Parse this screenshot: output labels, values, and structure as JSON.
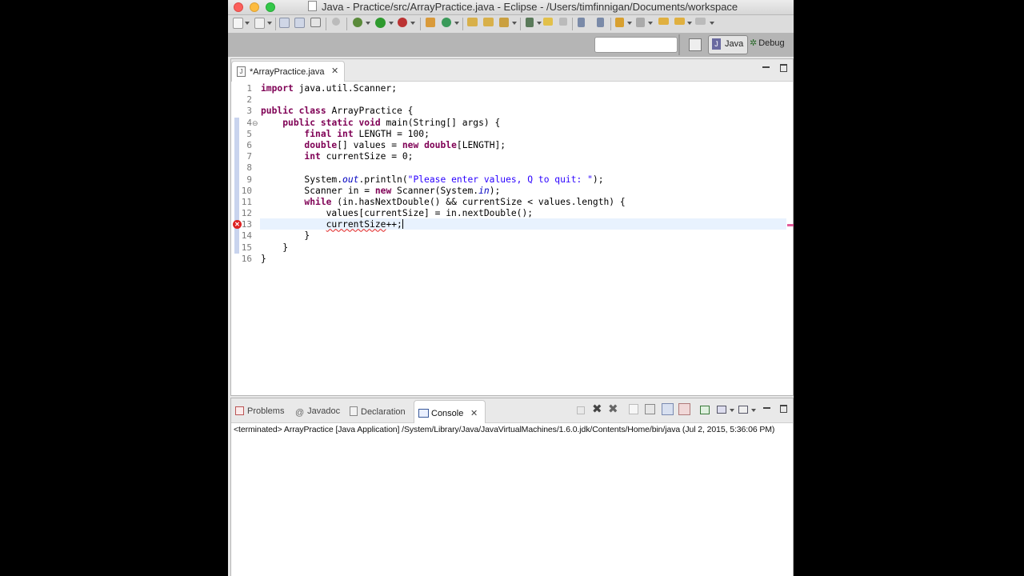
{
  "window": {
    "title": "Java - Practice/src/ArrayPractice.java - Eclipse - /Users/timfinnigan/Documents/workspace",
    "traffic_lights": {
      "close": "#fc605c",
      "minimize": "#fdbc40",
      "zoom": "#34c84a"
    }
  },
  "toolbar": {
    "icons": [
      "new-icon",
      "save-icon",
      "save-all-icon",
      "print-icon",
      "toggle-breakpoint-icon",
      "debug-icon",
      "run-icon",
      "external-tools-icon",
      "new-java-package-icon",
      "new-java-class-icon",
      "open-type-icon",
      "open-task-icon",
      "search-icon",
      "open-perspective-icon",
      "annotation-icon",
      "next-annotation-icon",
      "prev-annotation-icon",
      "back-icon",
      "forward-icon"
    ]
  },
  "quick_access": {
    "placeholder": ""
  },
  "perspectives": {
    "java_label": "Java",
    "debug_label": "Debug"
  },
  "editor": {
    "tab_label": "*ArrayPractice.java",
    "line_numbers": [
      "1",
      "2",
      "3",
      "4",
      "5",
      "6",
      "7",
      "8",
      "9",
      "10",
      "11",
      "12",
      "13",
      "14",
      "15",
      "16"
    ],
    "error_line": "13",
    "code": {
      "l1_kw": "import",
      "l1_rest": " java.util.Scanner;",
      "l3_kw1": "public",
      "l3_kw2": "class",
      "l3_rest": " ArrayPractice {",
      "l4_indent": "    ",
      "l4_kw1": "public",
      "l4_kw2": "static",
      "l4_kw3": "void",
      "l4_rest": " main(String[] args) {",
      "l5_indent": "        ",
      "l5_kw1": "final",
      "l5_kw2": "int",
      "l5_rest": " LENGTH = 100;",
      "l6_indent": "        ",
      "l6_kw1": "double",
      "l6_mid": "[] values = ",
      "l6_kw2": "new",
      "l6_kw3": "double",
      "l6_rest": "[LENGTH];",
      "l7_indent": "        ",
      "l7_kw": "int",
      "l7_rest": " currentSize = 0;",
      "l9_indent": "        ",
      "l9_a": "System.",
      "l9_out": "out",
      "l9_b": ".println(",
      "l9_str": "\"Please enter values, Q to quit: \"",
      "l9_c": ");",
      "l10_indent": "        ",
      "l10_a": "Scanner in = ",
      "l10_kw": "new",
      "l10_b": " Scanner(System.",
      "l10_in": "in",
      "l10_c": ");",
      "l11_indent": "        ",
      "l11_kw": "while",
      "l11_rest": " (in.hasNextDouble() && currentSize < values.length) {",
      "l12_indent": "            ",
      "l12_rest": "values[currentSize] = in.nextDouble();",
      "l13_indent": "            ",
      "l13_err": "currentSize",
      "l13_rest": "++;",
      "l14": "        }",
      "l15": "    }",
      "l16": "}"
    }
  },
  "console": {
    "tabs": {
      "problems": "Problems",
      "javadoc": "Javadoc",
      "declaration": "Declaration",
      "console": "Console"
    },
    "status": "<terminated> ArrayPractice [Java Application] /System/Library/Java/JavaVirtualMachines/1.6.0.jdk/Contents/Home/bin/java (Jul 2, 2015, 5:36:06 PM)"
  }
}
